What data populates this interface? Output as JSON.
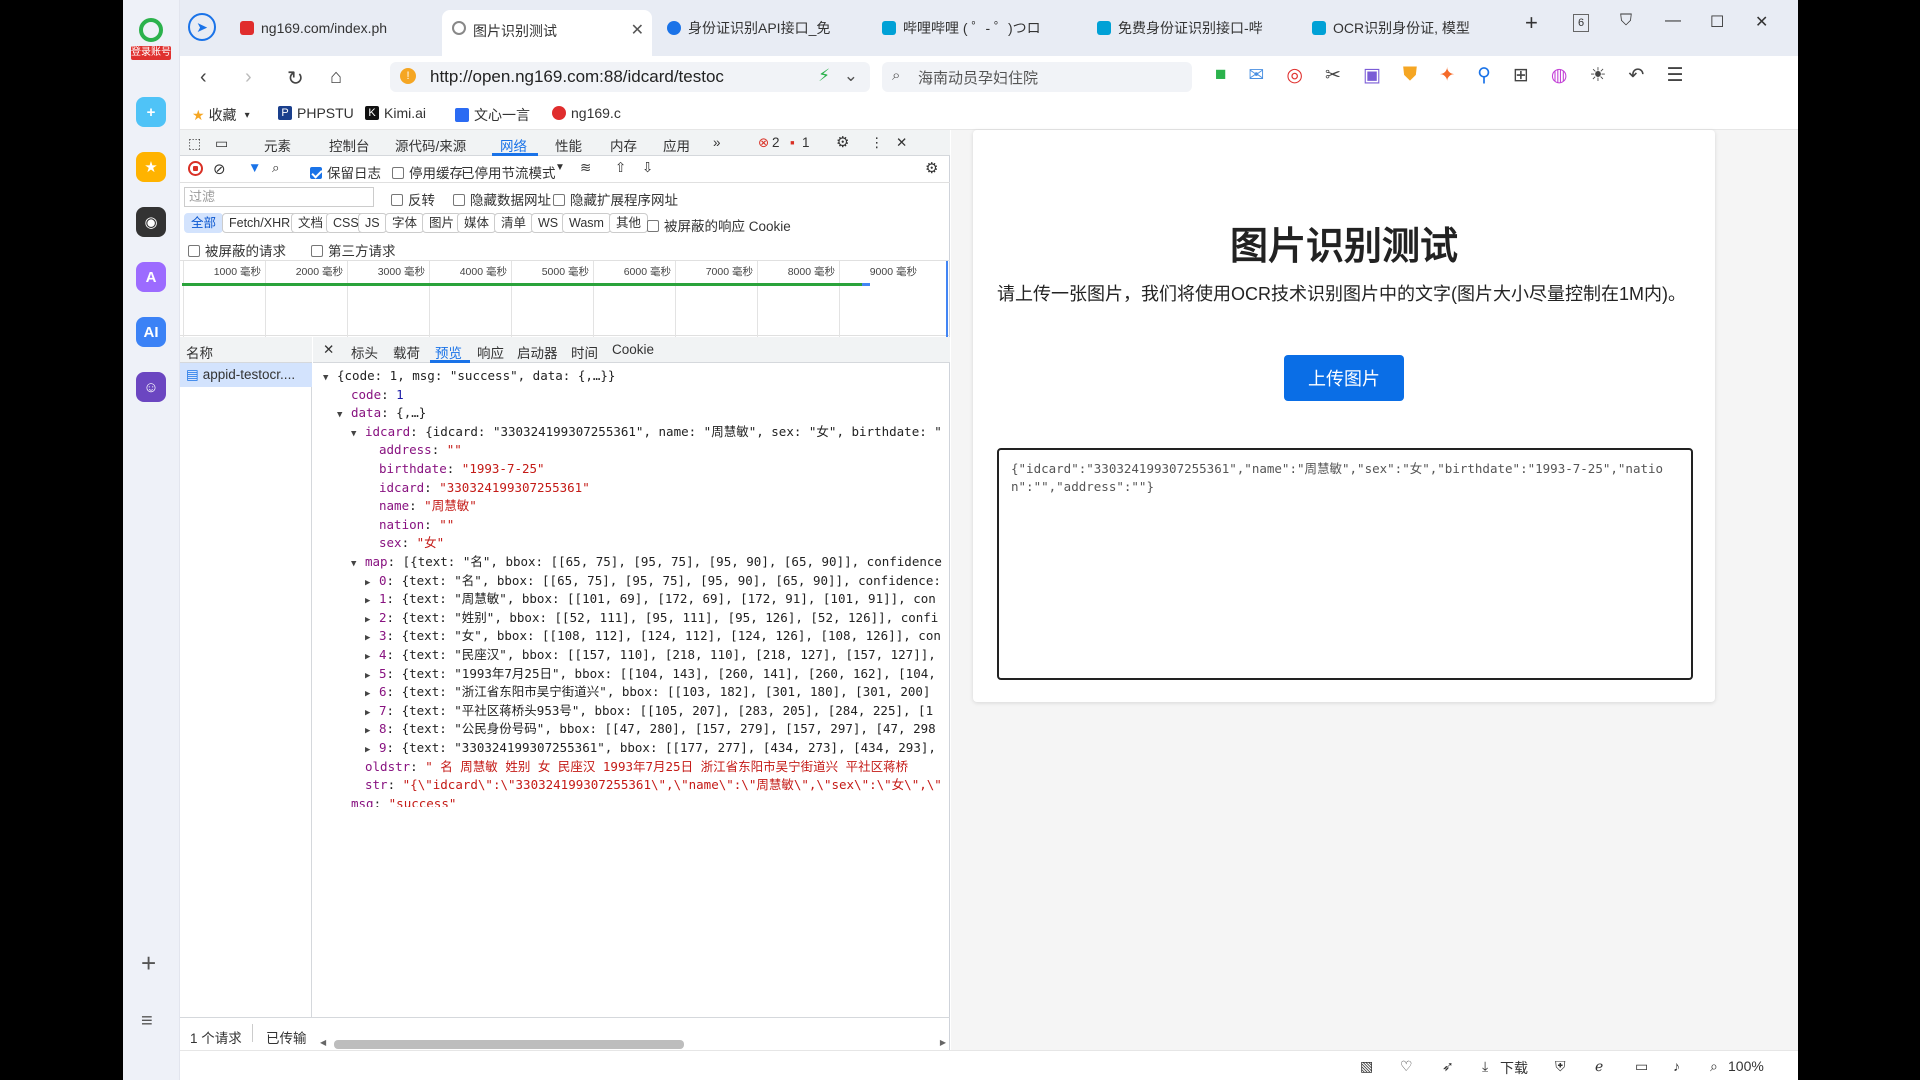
{
  "browser": {
    "login_badge": "登录账号",
    "tabs": [
      {
        "title": "ng169.com/index.ph",
        "fav_color": "#e02d2d"
      },
      {
        "title": "图片识别测试",
        "fav_color": "#888888"
      },
      {
        "title": "身份证识别API接口_免",
        "fav_color": "#1a73e8"
      },
      {
        "title": "哔哩哔哩 ( ゜- ゜)つロ",
        "fav_color": "#00a1d6"
      },
      {
        "title": "免费身份证识别接口-哔",
        "fav_color": "#00a1d6"
      },
      {
        "title": "OCR识别身份证, 模型",
        "fav_color": "#00a1d6"
      }
    ],
    "tab_count_badge": "6",
    "url": "http://open.ng169.com:88/idcard/testoc",
    "search_text": "海南动员孕妇住院",
    "bookmarks": [
      "收藏",
      "PHPSTU",
      "Kimi.ai",
      "文心一言",
      "ng169.c"
    ],
    "zoom": "100%",
    "download_label": "下载"
  },
  "devtools": {
    "main_tabs": [
      "元素",
      "控制台",
      "源代码/来源",
      "网络",
      "性能",
      "内存",
      "应用"
    ],
    "active_tab": "网络",
    "error_count": "2",
    "warn_count": "1",
    "toolbar": {
      "preserve_log": "保留日志",
      "disable_cache": "停用缓存",
      "throttle": "已停用节流模式"
    },
    "filter": {
      "placeholder": "过滤",
      "invert": "反转",
      "hide_data_urls": "隐藏数据网址",
      "hide_ext_urls": "隐藏扩展程序网址"
    },
    "types": [
      "全部",
      "Fetch/XHR",
      "文档",
      "CSS",
      "JS",
      "字体",
      "图片",
      "媒体",
      "清单",
      "WS",
      "Wasm",
      "其他"
    ],
    "blocked_cookies": "被屏蔽的响应 Cookie",
    "blocked_requests": "被屏蔽的请求",
    "third_party": "第三方请求",
    "timeline_ticks": [
      "1000 毫秒",
      "2000 毫秒",
      "3000 毫秒",
      "4000 毫秒",
      "5000 毫秒",
      "6000 毫秒",
      "7000 毫秒",
      "8000 毫秒",
      "9000 毫秒"
    ],
    "name_header": "名称",
    "request_name": "appid-testocr....",
    "panel_tabs": [
      "标头",
      "载荷",
      "预览",
      "响应",
      "启动器",
      "时间",
      "Cookie"
    ],
    "active_panel_tab": "预览",
    "preview": {
      "root": "{code: 1, msg: \"success\", data: {,…}}",
      "code": "1",
      "data_summary": "{,…}",
      "idcard_summary": "{idcard: \"330324199307255361\", name: \"周慧敏\", sex: \"女\", birthdate: \"",
      "address": "\"\"",
      "birthdate": "\"1993-7-25\"",
      "idcard": "\"330324199307255361\"",
      "name": "\"周慧敏\"",
      "nation": "\"\"",
      "sex": "\"女\"",
      "map_summary": "[{text: \"名\", bbox: [[65, 75], [95, 75], [95, 90], [65, 90]], confidence",
      "map_items": [
        "{text: \"名\", bbox: [[65, 75], [95, 75], [95, 90], [65, 90]], confidence:",
        "{text: \"周慧敏\", bbox: [[101, 69], [172, 69], [172, 91], [101, 91]], con",
        "{text: \"姓别\", bbox: [[52, 111], [95, 111], [95, 126], [52, 126]], confi",
        "{text: \"女\", bbox: [[108, 112], [124, 112], [124, 126], [108, 126]], con",
        "{text: \"民座汉\", bbox: [[157, 110], [218, 110], [218, 127], [157, 127]],",
        "{text: \"1993年7月25日\", bbox: [[104, 143], [260, 141], [260, 162], [104,",
        "{text: \"浙江省东阳市吴宁街道兴\", bbox: [[103, 182], [301, 180], [301, 200]",
        "{text: \"平社区蒋桥头953号\", bbox: [[105, 207], [283, 205], [284, 225], [1",
        "{text: \"公民身份号码\", bbox: [[47, 280], [157, 279], [157, 297], [47, 298",
        "{text: \"330324199307255361\", bbox: [[177, 277], [434, 273], [434, 293],"
      ],
      "oldstr": "\" 名 周慧敏 姓别 女 民座汉 1993年7月25日 浙江省东阳市吴宁街道兴 平社区蒋桥",
      "str": "\"{\\\"idcard\\\":\\\"330324199307255361\\\",\\\"name\\\":\\\"周慧敏\\\",\\\"sex\\\":\\\"女\\\",\\\"",
      "msg": "\"success\""
    },
    "status": {
      "requests": "1 个请求",
      "transferred": "已传输"
    }
  },
  "page": {
    "title": "图片识别测试",
    "description": "请上传一张图片，我们将使用OCR技术识别图片中的文字(图片大小尽量控制在1M内)。",
    "upload_label": "上传图片",
    "result": "{\"idcard\":\"330324199307255361\",\"name\":\"周慧敏\",\"sex\":\"女\",\"birthdate\":\"1993-7-25\",\"nation\":\"\",\"address\":\"\"}"
  }
}
